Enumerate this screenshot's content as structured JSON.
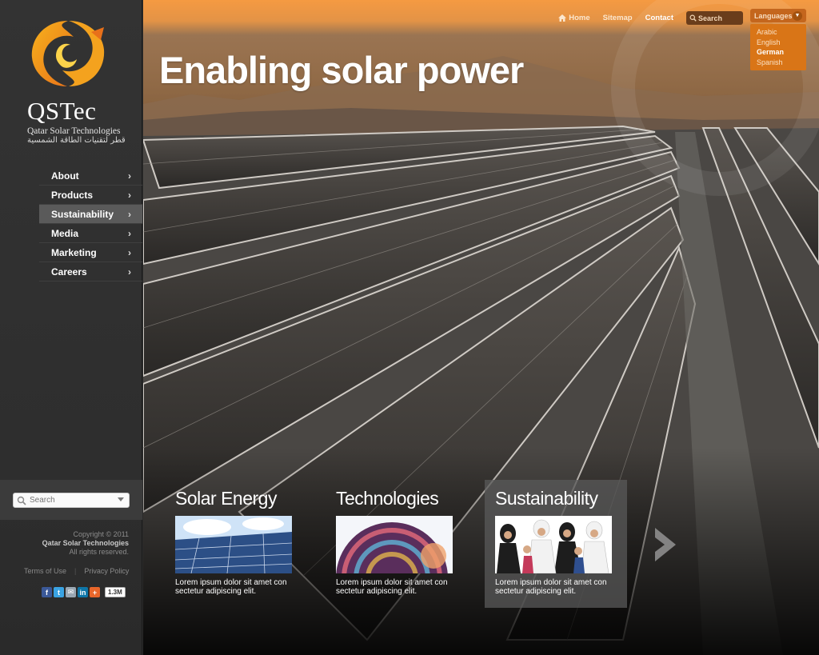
{
  "brand": {
    "name": "QSTec",
    "subtitle": "Qatar Solar Technologies",
    "arabic": "قطر لتقنيات الطاقة الشمسية",
    "colors": {
      "orange": "#f0901e",
      "dark": "#2e2e2e"
    }
  },
  "sidebar": {
    "nav": [
      {
        "label": "About",
        "active": false
      },
      {
        "label": "Products",
        "active": false
      },
      {
        "label": "Sustainability",
        "active": true
      },
      {
        "label": "Media",
        "active": false
      },
      {
        "label": "Marketing",
        "active": false
      },
      {
        "label": "Careers",
        "active": false
      }
    ],
    "search_placeholder": "Search",
    "copyright_line1": "Copyright © 2011",
    "copyright_company": "Qatar Solar Technologies",
    "copyright_line3": "All rights reserved.",
    "terms": "Terms of Use",
    "privacy": "Privacy Policy",
    "share_count": "1.3M"
  },
  "topnav": {
    "home": "Home",
    "sitemap": "Sitemap",
    "contact": "Contact",
    "search_label": "Search",
    "languages_label": "Languages",
    "languages": [
      "Arabic",
      "English",
      "German",
      "Spanish"
    ],
    "selected_language": "German"
  },
  "hero": {
    "title": "Enabling solar power"
  },
  "cards": [
    {
      "title": "Solar Energy",
      "text": "Lorem ipsum dolor sit amet con sectetur adipiscing elit."
    },
    {
      "title": "Technologies",
      "text": "Lorem ipsum dolor sit amet con sectetur adipiscing elit."
    },
    {
      "title": "Sustainability",
      "text": "Lorem ipsum dolor sit amet con sectetur adipiscing elit."
    }
  ]
}
